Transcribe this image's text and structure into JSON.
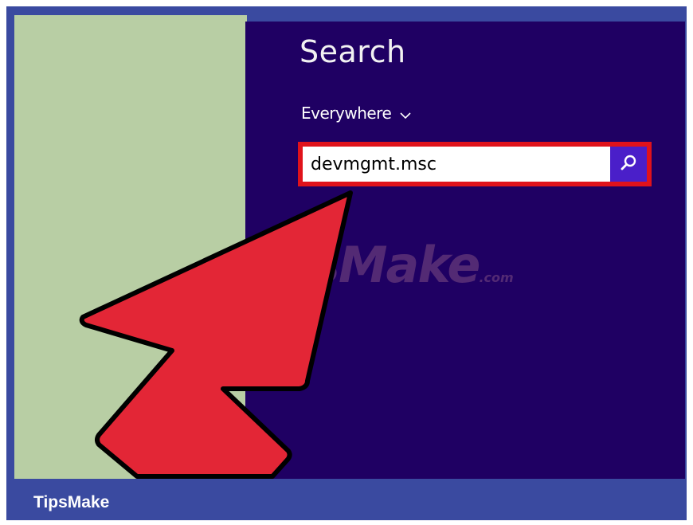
{
  "search_pane": {
    "title": "Search",
    "scope": {
      "label": "Everywhere",
      "icon": "chevron-down-icon"
    },
    "query": {
      "value": "devmgmt.msc",
      "placeholder": ""
    },
    "submit_icon": "search-icon",
    "highlight_color": "#e0121b",
    "background_color": "#1f0063",
    "accent_color": "#4a1fc9"
  },
  "overlay": {
    "pointer": "arrow-pointer-graphic",
    "pointer_color": "#e32636",
    "watermark_text": "TipsMake",
    "watermark_suffix": ".com"
  },
  "footer": {
    "brand": "TipsMake",
    "color": "#3a4aa0"
  }
}
